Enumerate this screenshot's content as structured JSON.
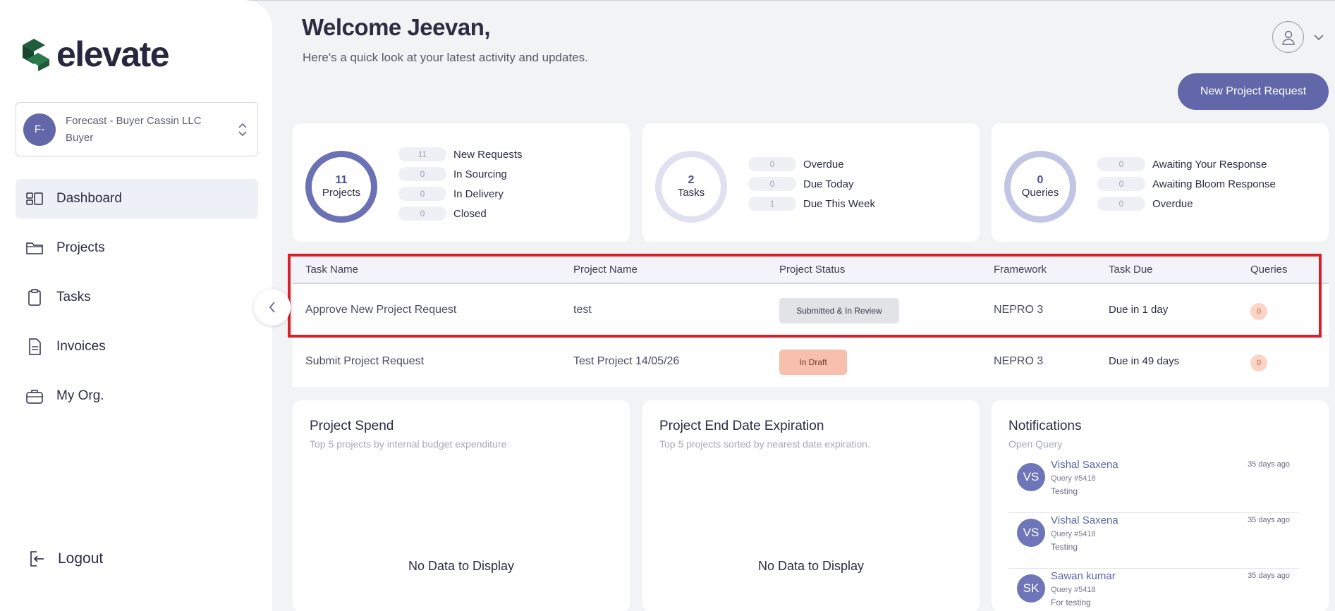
{
  "brand": {
    "name": "elevate"
  },
  "org": {
    "initials": "F-",
    "name": "Forecast - Buyer Cassin LLC",
    "role": "Buyer"
  },
  "nav": {
    "items": [
      {
        "label": "Dashboard",
        "icon": "dashboard-icon",
        "active": true
      },
      {
        "label": "Projects",
        "icon": "folder-icon"
      },
      {
        "label": "Tasks",
        "icon": "clipboard-icon"
      },
      {
        "label": "Invoices",
        "icon": "document-icon"
      },
      {
        "label": "My Org.",
        "icon": "briefcase-icon"
      }
    ],
    "logout": "Logout"
  },
  "header": {
    "welcome": "Welcome Jeevan,",
    "subtitle": "Here's a quick look at your latest activity and updates.",
    "new_request": "New Project Request"
  },
  "stats": {
    "projects": {
      "count": "11",
      "label": "Projects",
      "rows": [
        {
          "value": "11",
          "label": "New Requests"
        },
        {
          "value": "0",
          "label": "In Sourcing"
        },
        {
          "value": "0",
          "label": "In Delivery"
        },
        {
          "value": "0",
          "label": "Closed"
        }
      ]
    },
    "tasks": {
      "count": "2",
      "label": "Tasks",
      "rows": [
        {
          "value": "0",
          "label": "Overdue"
        },
        {
          "value": "0",
          "label": "Due Today"
        },
        {
          "value": "1",
          "label": "Due This Week"
        }
      ]
    },
    "queries": {
      "count": "0",
      "label": "Queries",
      "rows": [
        {
          "value": "0",
          "label": "Awaiting Your Response"
        },
        {
          "value": "0",
          "label": "Awaiting Bloom Response"
        },
        {
          "value": "0",
          "label": "Overdue"
        }
      ]
    }
  },
  "tasks_table": {
    "columns": [
      "Task Name",
      "Project Name",
      "Project Status",
      "Framework",
      "Task Due",
      "Queries"
    ],
    "rows": [
      {
        "task": "Approve New Project Request",
        "project": "test",
        "status": "Submitted & In Review",
        "framework": "NEPRO 3",
        "due": "Due in 1 day",
        "queries": "0"
      },
      {
        "task": "Submit Project Request",
        "project": "Test Project 14/05/26",
        "status": "In Draft",
        "framework": "NEPRO 3",
        "due": "Due in 49 days",
        "queries": "0"
      }
    ]
  },
  "project_spend": {
    "title": "Project Spend",
    "subtitle": "Top 5 projects by internal budget expenditure",
    "empty": "No Data to Display"
  },
  "project_end": {
    "title": "Project End Date Expiration",
    "subtitle": "Top 5 projects sorted by nearest date expiration.",
    "empty": "No Data to Display"
  },
  "notifications": {
    "title": "Notifications",
    "subtitle": "Open Query",
    "items": [
      {
        "initials": "VS",
        "name": "Vishal Saxena",
        "query": "Query #5418",
        "message": "Testing",
        "time": "35 days ago"
      },
      {
        "initials": "VS",
        "name": "Vishal Saxena",
        "query": "Query #5418",
        "message": "Testing",
        "time": "35 days ago"
      },
      {
        "initials": "SK",
        "name": "Sawan kumar",
        "query": "Query #5418",
        "message": "For testing",
        "time": "35 days ago"
      }
    ]
  },
  "colors": {
    "accent": "#6167a8",
    "highlight": "#d8202a",
    "draft": "#f9bfae"
  }
}
